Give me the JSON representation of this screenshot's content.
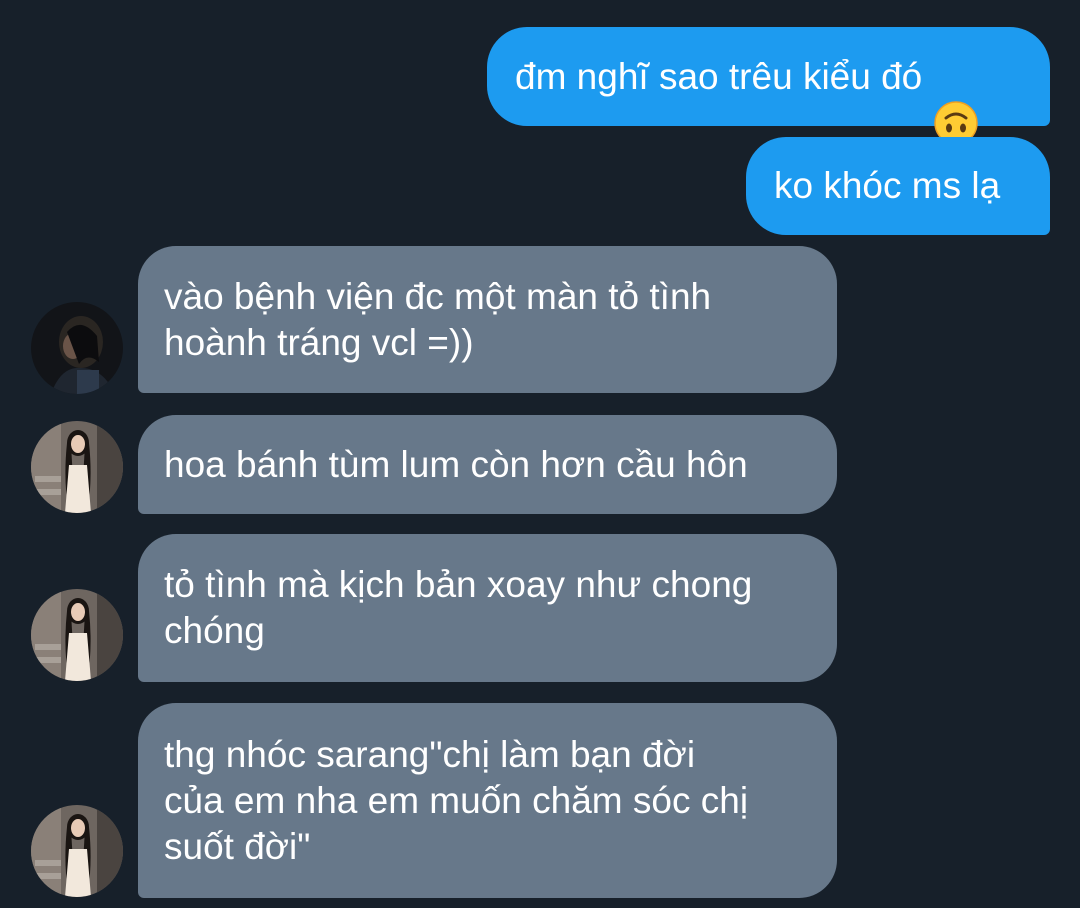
{
  "messages": {
    "sent": [
      {
        "text": "đm nghĩ sao trêu kiểu đó",
        "emoji": "upside-down-face"
      },
      {
        "text": "ko khóc ms lạ"
      }
    ],
    "received": [
      {
        "text": "vào bệnh viện đc một màn tỏ tình\nhoành tráng vcl =))",
        "avatar": "dark-portrait"
      },
      {
        "text": "hoa bánh tùm lum còn hơn cầu hôn",
        "avatar": "white-dress-portrait"
      },
      {
        "text": "tỏ tình mà kịch bản xoay như chong\nchóng",
        "avatar": "white-dress-portrait"
      },
      {
        "text": "thg nhóc sarang\"chị làm bạn đời\ncủa em nha em muốn chăm sóc chị\nsuốt đời\"",
        "avatar": "white-dress-portrait"
      }
    ]
  },
  "colors": {
    "background": "#17202a",
    "sent_bubble": "#1d9bf0",
    "received_bubble": "#67788a",
    "text": "#ffffff"
  }
}
